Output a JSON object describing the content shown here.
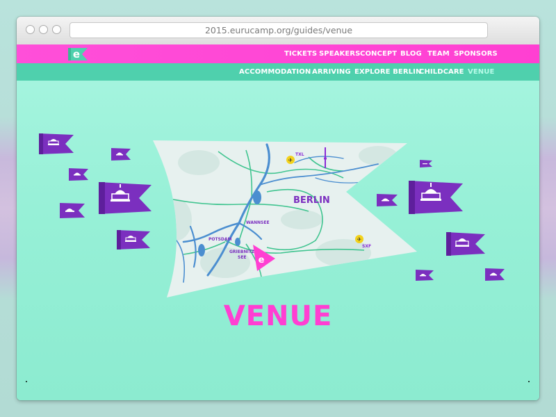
{
  "browser": {
    "url": "2015.eurucamp.org/guides/venue"
  },
  "top_nav": {
    "items": [
      "TICKETS",
      "SPEAKERS",
      "CONCEPT",
      "BLOG",
      "TEAM",
      "SPONSORS"
    ]
  },
  "sub_nav": {
    "items": [
      "ACCOMMODATION",
      "ARRIVING",
      "EXPLORE BERLIN",
      "CHILDCARE",
      "VENUE"
    ],
    "active": "VENUE"
  },
  "logo": {
    "letter": "e"
  },
  "map": {
    "city_label": "BERLIN",
    "place_labels": {
      "txl": "TXL",
      "sxf": "SXF",
      "potsdam": "POTSDAM",
      "wannsee": "WANNSEE",
      "griebnitzsee_line1": "GRIEBNITZ-",
      "griebnitzsee_line2": "SEE"
    }
  },
  "page": {
    "heading": "VENUE"
  },
  "colors": {
    "pink": "#ff3fd2",
    "mint": "#9ff2dc",
    "teal_nav": "#4fd0ad",
    "purple_flag": "#7b2fbf",
    "map_water": "#4b8ed0",
    "map_roads": "#3fc48f"
  }
}
